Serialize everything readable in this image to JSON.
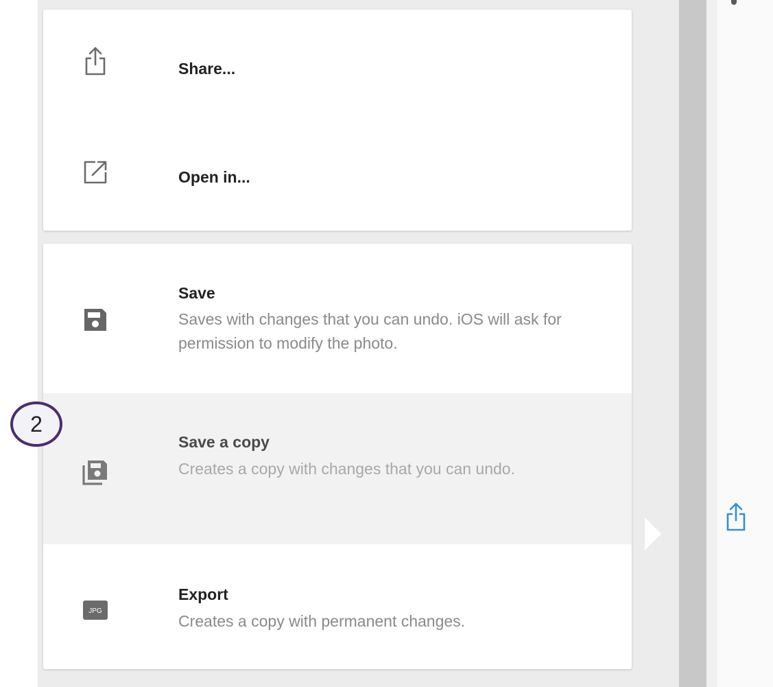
{
  "menu": {
    "share": {
      "label": "Share...",
      "icon": "share-icon"
    },
    "open_in": {
      "label": "Open in...",
      "icon": "open-in-icon"
    },
    "save": {
      "title": "Save",
      "description": "Saves with changes that you can undo. iOS will ask for permission to modify the photo.",
      "icon": "save-icon"
    },
    "save_copy": {
      "title": "Save a copy",
      "description": "Creates a copy with changes that you can undo.",
      "icon": "save-copy-icon"
    },
    "export": {
      "title": "Export",
      "description": "Creates a copy with permanent changes.",
      "icon": "jpg-file-icon",
      "icon_text": "JPG"
    }
  },
  "annotation": {
    "step": "2",
    "color": "#4b2d6e"
  },
  "colors": {
    "icon_gray": "#6b6b6b",
    "accent_blue": "#2f8fe0",
    "highlight_row": "#f2f2f2"
  }
}
